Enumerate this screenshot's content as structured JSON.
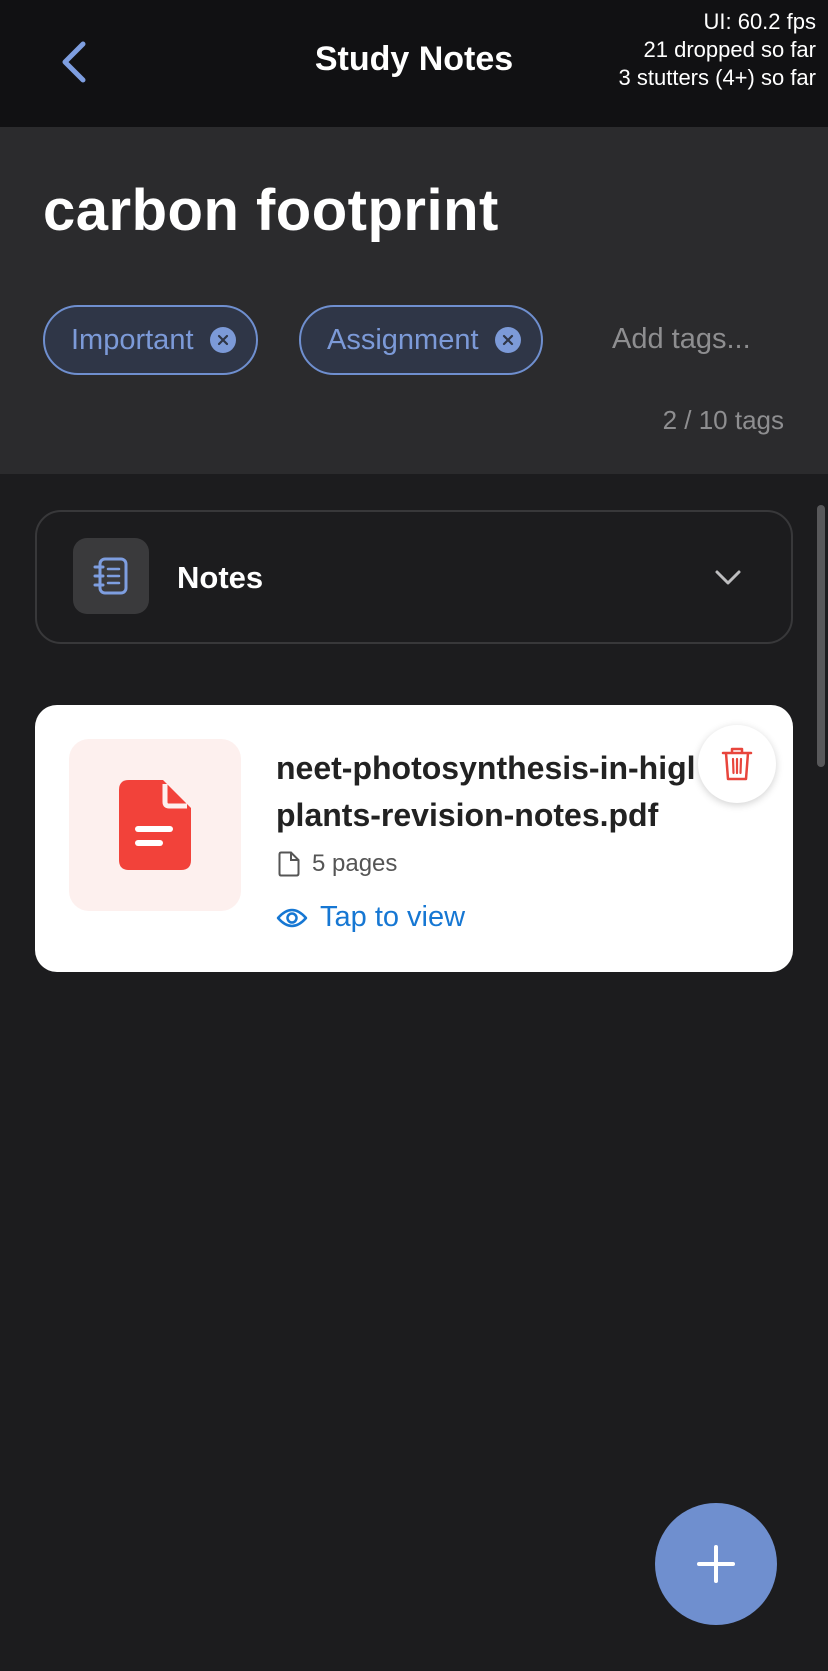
{
  "header": {
    "title": "Study Notes",
    "back_icon": "chevron-left-icon"
  },
  "perf_overlay": {
    "fps": "UI: 60.2 fps",
    "dropped": "21 dropped so far",
    "stutters": "3 stutters (4+) so far"
  },
  "note": {
    "title": "carbon footprint"
  },
  "tags": {
    "items": [
      {
        "label": "Important"
      },
      {
        "label": "Assignment"
      }
    ],
    "input_placeholder": "Add tags...",
    "count": "2 / 10 tags"
  },
  "section": {
    "label": "Notes",
    "icon": "notebook-icon",
    "expand_icon": "chevron-down-icon"
  },
  "file": {
    "name_line1": "neet-photosynthesis-in-higl",
    "name_line2": "plants-revision-notes.pdf",
    "pages": "5 pages",
    "view_label": "Tap to view",
    "icon": "pdf-document-icon",
    "delete_icon": "trash-icon"
  },
  "fab": {
    "icon": "plus-icon"
  },
  "colors": {
    "accent": "#6f8fcf",
    "link": "#1677d3",
    "danger": "#e8453c",
    "background": "#1c1c1e"
  }
}
